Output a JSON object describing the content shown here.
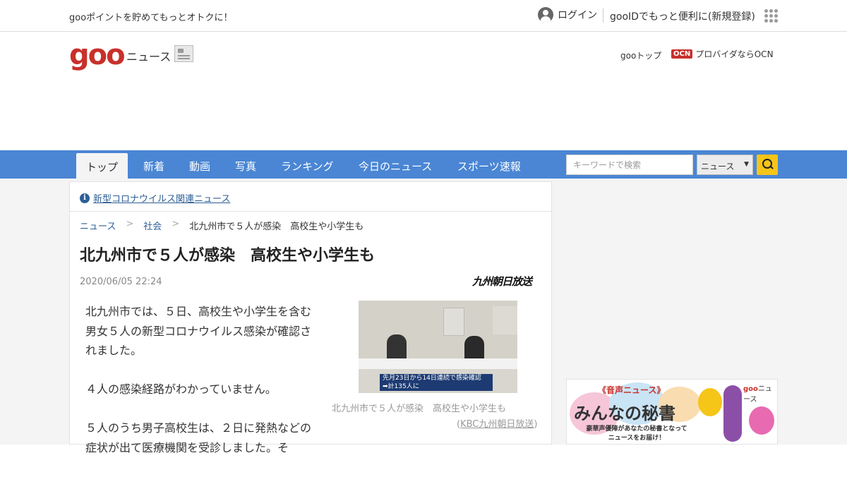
{
  "topbar": {
    "promo": "gooポイントを貯めてもっとオトクに！",
    "login": "ログイン",
    "register": "gooIDでもっと便利に(新規登録)"
  },
  "header": {
    "logo": "goo",
    "section": "ニュース",
    "goo_top": "gooトップ",
    "ocn_logo": "OCN",
    "ocn_label": "プロバイダならOCN"
  },
  "nav": {
    "tabs": [
      {
        "label": "トップ",
        "active": true
      },
      {
        "label": "新着"
      },
      {
        "label": "動画"
      },
      {
        "label": "写真"
      },
      {
        "label": "ランキング"
      },
      {
        "label": "今日のニュース"
      },
      {
        "label": "スポーツ速報"
      }
    ],
    "search_placeholder": "キーワードで検索",
    "search_scope": "ニュース"
  },
  "notice": "新型コロナウイルス関連ニュース",
  "breadcrumb": [
    "ニュース",
    "社会",
    "北九州市で５人が感染　高校生や小学生も"
  ],
  "article": {
    "title": "北九州市で５人が感染　高校生や小学生も",
    "date": "2020/06/05 22:24",
    "source": "九州朝日放送",
    "paragraphs": [
      "北九州市では、５日、高校生や小学生を含む男女５人の新型コロナウイルス感染が確認されました。",
      "４人の感染経路がわかっていません。",
      "５人のうち男子高校生は、２日に発熱などの症状が出て医療機関を受診しました。そ"
    ],
    "photo_caption": "北九州市で５人が感染　高校生や小学生も",
    "photo_credit": "KBC九州朝日放送",
    "photo_overlay_1": "先月23日から14日連続で感染確認",
    "photo_overlay_2": "➡計135人に"
  },
  "ad": {
    "audio_label": "《音声ニュース》",
    "title": "みんなの秘書",
    "sub_1": "豪華声優陣があなたの秘書となって",
    "sub_2": "ニュースをお届け！",
    "brand_logo": "goo",
    "brand_label": "ニュース"
  }
}
